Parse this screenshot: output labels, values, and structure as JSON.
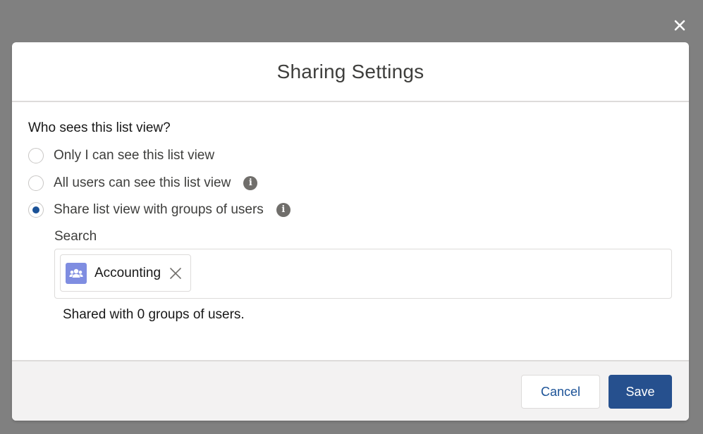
{
  "modal": {
    "title": "Sharing Settings",
    "question": "Who sees this list view?",
    "options": [
      {
        "label": "Only I can see this list view",
        "selected": false,
        "has_info": false
      },
      {
        "label": "All users can see this list view",
        "selected": false,
        "has_info": true
      },
      {
        "label": "Share list view with groups of users",
        "selected": true,
        "has_info": true
      }
    ],
    "search": {
      "label": "Search",
      "selected_pill": {
        "label": "Accounting",
        "icon": "group-icon"
      }
    },
    "shared_count_text": "Shared with 0 groups of users.",
    "footer": {
      "cancel_label": "Cancel",
      "save_label": "Save"
    }
  },
  "icons": {
    "close": "close-icon",
    "info": "info-icon",
    "remove": "remove-x-icon"
  },
  "colors": {
    "backdrop": "#808080",
    "brand": "#26508e",
    "radio_selected": "#1b5297",
    "group_icon_bg": "#7f8de1",
    "info_icon_bg": "#706e6b"
  }
}
